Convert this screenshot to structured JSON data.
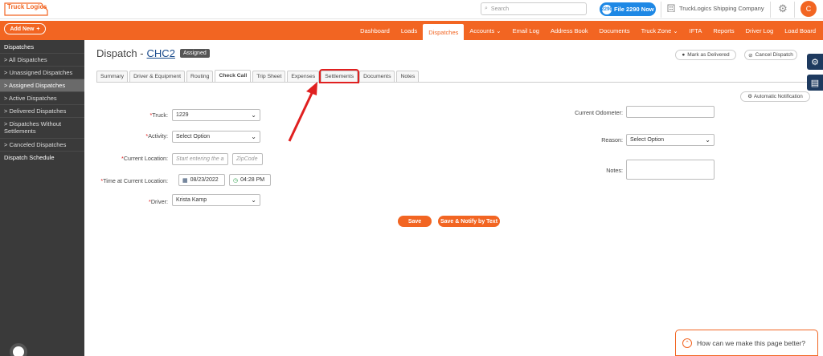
{
  "header": {
    "logo": "Truck Logics",
    "search_placeholder": "Search",
    "file_button": "File 2290 Now",
    "file_icon": "2290",
    "company": "TruckLogics Shipping Company",
    "avatar_initial": "C"
  },
  "navbar": {
    "add_new": "Add New",
    "items": [
      {
        "label": "Dashboard"
      },
      {
        "label": "Loads"
      },
      {
        "label": "Dispatches",
        "active": true
      },
      {
        "label": "Accounts ⌄"
      },
      {
        "label": "Email Log"
      },
      {
        "label": "Address Book"
      },
      {
        "label": "Documents"
      },
      {
        "label": "Truck Zone ⌄"
      },
      {
        "label": "IFTA"
      },
      {
        "label": "Reports"
      },
      {
        "label": "Driver Log"
      },
      {
        "label": "Load Board"
      }
    ]
  },
  "sidebar": {
    "heading": "Dispatches",
    "items": [
      {
        "label": "> All Dispatches"
      },
      {
        "label": "> Unassigned Dispatches"
      },
      {
        "label": "> Assigned Dispatches",
        "active": true
      },
      {
        "label": "> Active Dispatches"
      },
      {
        "label": "> Delivered Dispatches"
      },
      {
        "label": "> Dispatches Without Settlements"
      },
      {
        "label": "> Canceled Dispatches"
      }
    ],
    "schedule": "Dispatch Schedule"
  },
  "page": {
    "title_prefix": "Dispatch - ",
    "dispatch_id": "CHC2",
    "status": "Assigned",
    "mark_delivered": "Mark as Delivered",
    "cancel_dispatch": "Cancel Dispatch",
    "auto_notification": "Automatic Notification"
  },
  "tabs": [
    {
      "label": "Summary"
    },
    {
      "label": "Driver & Equipment"
    },
    {
      "label": "Routing"
    },
    {
      "label": "Check Call",
      "active": true
    },
    {
      "label": "Trip Sheet"
    },
    {
      "label": "Expenses"
    },
    {
      "label": "Settlements",
      "highlight": true
    },
    {
      "label": "Documents"
    },
    {
      "label": "Notes"
    }
  ],
  "form": {
    "truck_label": "Truck:",
    "truck_value": "1229",
    "activity_label": "Activity:",
    "activity_value": "Select Option",
    "location_label": "Current Location:",
    "location_placeholder": "Start entering the a",
    "zip_placeholder": "ZipCode",
    "time_label": "Time at Current Location:",
    "date_value": "08/23/2022",
    "time_value": "04:28 PM",
    "driver_label": "Driver:",
    "driver_value": "Krista Kamp",
    "odometer_label": "Current Odometer:",
    "reason_label": "Reason:",
    "reason_value": "Select Option",
    "notes_label": "Notes:",
    "required_mark": "*"
  },
  "actions": {
    "save": "Save",
    "save_notify": "Save & Notify by Text"
  },
  "feedback": {
    "text": "How can we make this page better?"
  },
  "colors": {
    "brand": "#f26522",
    "sidebar": "#3a3a3a",
    "annotation": "#e02020"
  }
}
